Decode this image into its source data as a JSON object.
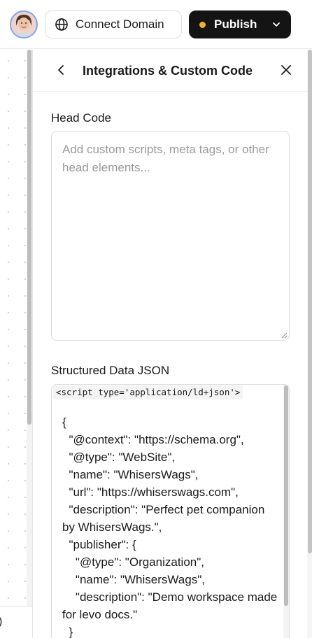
{
  "topbar": {
    "avatar_icon": "user-avatar",
    "connect_domain_label": "Connect Domain",
    "connect_domain_icon": "globe-icon",
    "publish_label": "Publish",
    "publish_status_color": "#f0b323",
    "publish_menu_icon": "chevron-down-icon"
  },
  "canvas": {
    "cutoff_text": ")"
  },
  "panel": {
    "back_icon": "chevron-left-icon",
    "title": "Integrations & Custom Code",
    "close_icon": "close-icon",
    "head_code": {
      "label": "Head Code",
      "placeholder": "Add custom scripts, meta tags, or other head elements...",
      "value": ""
    },
    "structured_data": {
      "label": "Structured Data JSON",
      "script_tag": "<script type='application/ld+json'>",
      "code": "{\n  \"@context\": \"https://schema.org\",\n  \"@type\": \"WebSite\",\n  \"name\": \"WhisersWags\",\n  \"url\": \"https://whiserswags.com\",\n  \"description\": \"Perfect pet companion by WhisersWags.\",\n  \"publisher\": {\n    \"@type\": \"Organization\",\n    \"name\": \"WhisersWags\",\n    \"description\": \"Demo workspace made for levo docs.\"\n  }"
    }
  },
  "colors": {
    "publish_bg": "#141414",
    "accent_ring": "#7aa5ef"
  }
}
